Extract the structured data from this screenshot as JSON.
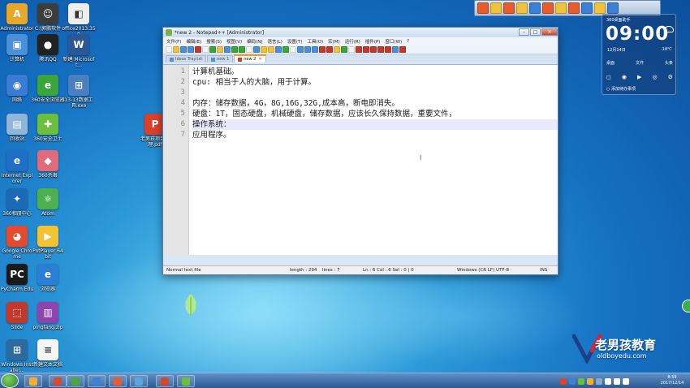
{
  "desktop": {
    "icons": [
      {
        "label": "Administrator",
        "color": "#e6a72b",
        "glyph": "A"
      },
      {
        "label": "C:\\郭鹏软件",
        "color": "#3c3c3c",
        "glyph": "☺"
      },
      {
        "label": "office2013.350",
        "color": "#eeeeee",
        "glyph": "◧"
      },
      {
        "label": "计算机",
        "color": "#4a90d9",
        "glyph": "▣"
      },
      {
        "label": "腾讯QQ",
        "color": "#222222",
        "glyph": "●"
      },
      {
        "label": "新建 Microsoft...",
        "color": "#2b5797",
        "glyph": "W"
      },
      {
        "label": "网络",
        "color": "#3a7bd5",
        "glyph": "◉"
      },
      {
        "label": "360安全浏览器",
        "color": "#3aa53a",
        "glyph": "e"
      },
      {
        "label": "13-13数据工具.exe",
        "color": "#4a7fc1",
        "glyph": "⊞"
      },
      {
        "label": "回收站",
        "color": "#8fb6d8",
        "glyph": "▤"
      },
      {
        "label": "360安全卫士",
        "color": "#6cbf3c",
        "glyph": "✚"
      },
      {
        "label": "老男孩项目经理.pdf",
        "color": "#d9412b",
        "glyph": "P"
      },
      {
        "label": "Internet Explorer",
        "color": "#1f6fc5",
        "glyph": "e"
      },
      {
        "label": "360杀毒",
        "color": "#e26a7b",
        "glyph": "◆"
      },
      {
        "label": "360相册中心",
        "color": "#1a6ab8",
        "glyph": "✦"
      },
      {
        "label": "Atom",
        "color": "#4caf50",
        "glyph": "⚛"
      },
      {
        "label": "Google Chrome",
        "color": "#e64a2e",
        "glyph": "◕"
      },
      {
        "label": "PotPlayer 64 bit",
        "color": "#f2c230",
        "glyph": "▶"
      },
      {
        "label": "PyCharm Edu",
        "color": "#1a1a1a",
        "glyph": "PC"
      },
      {
        "label": "浏览器",
        "color": "#2a7ed4",
        "glyph": "e"
      },
      {
        "label": "Slide",
        "color": "#c0392b",
        "glyph": "⬚"
      },
      {
        "label": "pingfang.zip",
        "color": "#8e44ad",
        "glyph": "▥"
      },
      {
        "label": "Windows Installer...",
        "color": "#2d6a9f",
        "glyph": "⊞"
      },
      {
        "label": "新建文本文档",
        "color": "#f5f5f5",
        "glyph": "≡"
      }
    ]
  },
  "topbar": {
    "buttons": [
      "#e85b2c",
      "#f3c23b",
      "#e85b2c",
      "#f3c23b",
      "#3b7fd6",
      "#e85b2c",
      "#f3c23b",
      "#e85b2c",
      "#3b7fd6",
      "#f3c23b",
      "#3b7fd6"
    ]
  },
  "widget": {
    "title": "360桌面助手",
    "time": "09:00",
    "date": "12月14日",
    "temp": "-18℃",
    "shortcuts": [
      "桌面",
      "文件",
      "头条"
    ],
    "icons": [
      "◻",
      "◉",
      "▶",
      "◎",
      "⚙"
    ],
    "footer": "○ 添加待办事项"
  },
  "notepad": {
    "title": "*new 2 - Notepad++ [Administrator]",
    "menu": [
      "文件(F)",
      "编辑(E)",
      "搜索(S)",
      "视图(V)",
      "编码(N)",
      "语言(L)",
      "设置(T)",
      "工具(O)",
      "宏(M)",
      "运行(R)",
      "插件(P)",
      "窗口(W)",
      "?"
    ],
    "tabs": [
      {
        "label": "Ideas Tray.txt",
        "active": false
      },
      {
        "label": "new 1",
        "active": false
      },
      {
        "label": "new 2",
        "active": true
      }
    ],
    "lines": [
      {
        "num": "1",
        "text": "计算机基础。"
      },
      {
        "num": "2",
        "text": "cpu: 相当于人的大脑，用于计算。"
      },
      {
        "num": "3",
        "text": ""
      },
      {
        "num": "4",
        "text": "内存：储存数据，4G，8G,16G,32G,成本高，断电即消失。"
      },
      {
        "num": "5",
        "text": "硬盘：1T，固态硬盘，机械硬盘，储存数据，应该长久保持数据，重要文件，"
      },
      {
        "num": "6",
        "text": "操作系统："
      },
      {
        "num": "7",
        "text": "应用程序。"
      }
    ],
    "cursor_glyph": "I",
    "status": {
      "type": "Normal text file",
      "length": "length : 294",
      "lines": "lines : 7",
      "pos": "Ln : 6    Col : 6    Sel : 0 | 0",
      "eol": "Windows (CR LF)",
      "encoding": "UTF-8",
      "mode": "INS"
    }
  },
  "brand": {
    "name": "老男孩教育",
    "url": "oldboyedu.com"
  },
  "taskbar": {
    "apps": [
      "#f0b030",
      "#d84a34",
      "#4aa83a",
      "#3b82d6",
      "#e85b2c",
      "#5aa6e0",
      "#d6452f",
      "#6cbf3c"
    ],
    "tray": [
      "#d6452f",
      "#3b82d6",
      "#6cbf3c",
      "#f0b030",
      "#8aa7c8",
      "#ffffff",
      "#ffffff",
      "#ffffff"
    ],
    "time": "8:59",
    "date": "2017/12/14"
  }
}
